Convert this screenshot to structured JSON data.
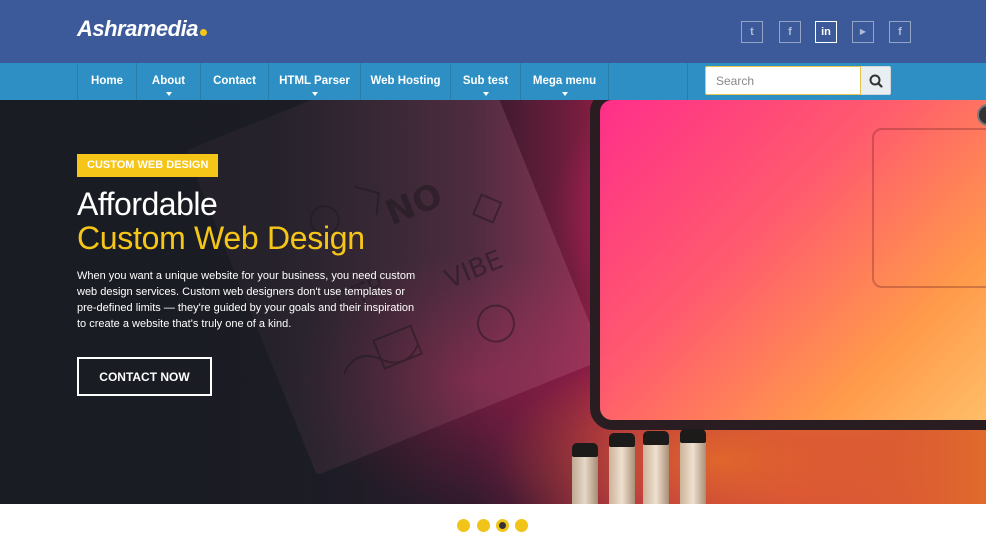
{
  "brand": {
    "logo_text": "Ashramedia",
    "accent": "#f5c518",
    "header_bg": "#3c5a9a",
    "nav_bg": "#2d8fc4"
  },
  "social": [
    {
      "icon": "twitter-icon",
      "glyph": "t"
    },
    {
      "icon": "facebook-icon",
      "glyph": "f"
    },
    {
      "icon": "linkedin-icon",
      "glyph": "in"
    },
    {
      "icon": "youtube-icon",
      "glyph": "▶"
    },
    {
      "icon": "facebook-icon",
      "glyph": "f"
    }
  ],
  "nav": {
    "items": [
      {
        "label": "Home",
        "has_dropdown": false
      },
      {
        "label": "About",
        "has_dropdown": true
      },
      {
        "label": "Contact",
        "has_dropdown": false
      },
      {
        "label": "HTML Parser",
        "has_dropdown": true
      },
      {
        "label": "Web Hosting",
        "has_dropdown": false
      },
      {
        "label": "Sub test",
        "has_dropdown": true
      },
      {
        "label": "Mega menu",
        "has_dropdown": true
      }
    ]
  },
  "search": {
    "placeholder": "Search",
    "value": ""
  },
  "hero": {
    "tag": "CUSTOM WEB DESIGN",
    "title_line1": "Affordable",
    "title_line2": "Custom Web Design",
    "description": "When you want a unique website for your business, you need custom web design services. Custom web designers don't use templates or pre-defined limits — they're guided by your goals and their inspiration to create a website that's truly one of a kind.",
    "cta_label": "CONTACT NOW"
  },
  "slider": {
    "total": 4,
    "active_index": 2
  }
}
